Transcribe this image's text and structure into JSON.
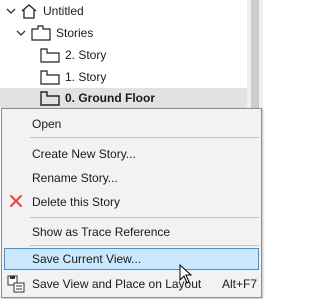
{
  "tree": {
    "root_label": "Untitled",
    "group_label": "Stories",
    "stories": [
      {
        "label": "2. Story"
      },
      {
        "label": "1. Story"
      },
      {
        "label": "0. Ground Floor"
      }
    ],
    "selected_index": 2
  },
  "context_menu": {
    "items": {
      "open": "Open",
      "create_new_story": "Create New Story...",
      "rename_story": "Rename Story...",
      "delete_story": "Delete this Story",
      "trace_reference": "Show as Trace Reference",
      "save_current_view": "Save Current View...",
      "save_view_place": "Save View and Place on Layout",
      "save_view_place_shortcut": "Alt+F7"
    },
    "hovered_item": "save_current_view"
  },
  "colors": {
    "hover_fill": "#cce8ff",
    "hover_border": "#4a90d9",
    "delete_icon": "#e8463c",
    "menu_bg": "#f2f2f2",
    "selected_row": "#e2e2e2"
  },
  "icons": {
    "root": "project-house-icon",
    "group": "folder-icon",
    "story": "story-floor-icon",
    "delete": "red-x-icon",
    "save_place": "save-view-layout-icon"
  }
}
